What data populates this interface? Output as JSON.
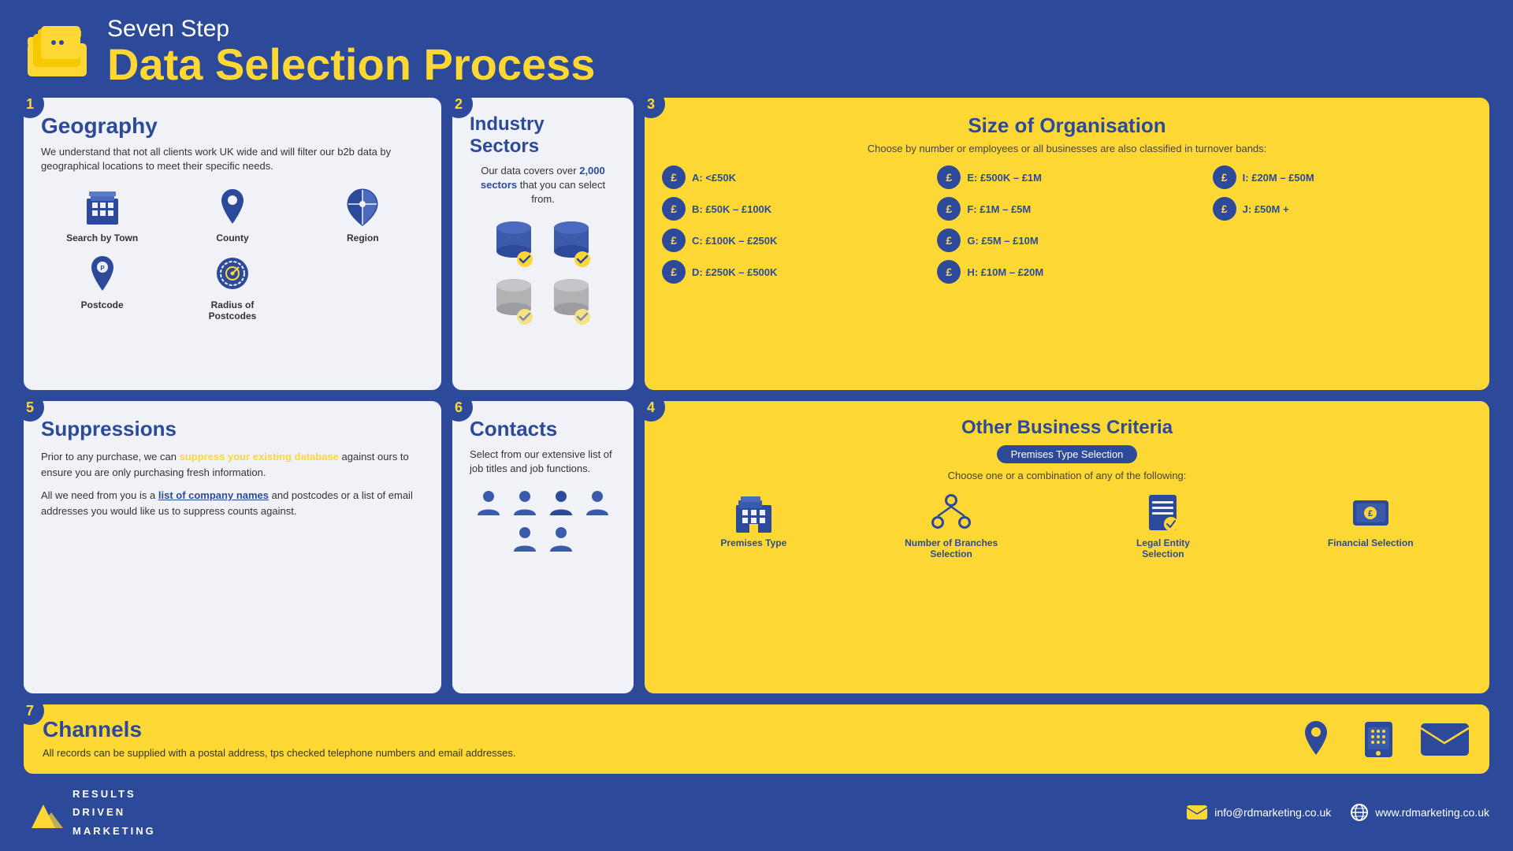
{
  "header": {
    "subtitle": "Seven Step",
    "title": "Data Selection Process"
  },
  "footer": {
    "logo_line1": "RESULTS",
    "logo_line2": "DRIVEN",
    "logo_line3": "MARKETING",
    "email_label": "info@rdmarketing.co.uk",
    "website_label": "www.rdmarketing.co.uk"
  },
  "steps": {
    "geography": {
      "step_num": "1",
      "title": "Geography",
      "description": "We understand that not all clients work UK wide and will filter our b2b data by geographical locations to meet their specific needs.",
      "icons": [
        {
          "label": "Search by Town",
          "type": "building"
        },
        {
          "label": "County",
          "type": "pin"
        },
        {
          "label": "Region",
          "type": "region"
        },
        {
          "label": "Postcode",
          "type": "postcode"
        },
        {
          "label": "Radius of Postcodes",
          "type": "radius"
        }
      ]
    },
    "industry": {
      "step_num": "2",
      "title": "Industry Sectors",
      "description": "Our data covers over ",
      "highlight": "2,000 sectors",
      "description2": " that you can select from."
    },
    "size": {
      "step_num": "3",
      "title": "Size of Organisation",
      "subtitle": "Choose by number or employees or all businesses are also classified in turnover bands:",
      "bands": [
        "A: <£50K",
        "E: £500K – £1M",
        "I: £20M – £50M",
        "B: £50K – £100K",
        "F: £1M – £5M",
        "J: £50M +",
        "C: £100K – £250K",
        "G: £5M – £10M",
        "",
        "D: £250K – £500K",
        "H: £10M – £20M",
        ""
      ]
    },
    "other_business": {
      "step_num": "4",
      "title": "Other Business Criteria",
      "badge": "Premises Type Selection",
      "subtitle": "Choose one or a combination of any of the following:",
      "items": [
        {
          "label": "Premises Type"
        },
        {
          "label": "Number of Branches Selection"
        },
        {
          "label": "Legal Entity Selection"
        },
        {
          "label": "Financial Selection"
        }
      ]
    },
    "suppressions": {
      "step_num": "5",
      "title": "Suppressions",
      "para1_before": "Prior to any purchase, we can ",
      "para1_highlight": "suppress your existing database",
      "para1_after": " against ours to ensure you are only purchasing fresh information.",
      "para2_before": "All we need from you is a ",
      "para2_highlight": "list of company names",
      "para2_after": " and postcodes or a list of email addresses you would like us to suppress counts against."
    },
    "contacts": {
      "step_num": "6",
      "title": "Contacts",
      "description": "Select from our extensive list of job titles and job functions."
    },
    "channels": {
      "step_num": "7",
      "title": "Channels",
      "description": "All records can be supplied with a postal address, tps checked telephone numbers and email addresses."
    }
  }
}
